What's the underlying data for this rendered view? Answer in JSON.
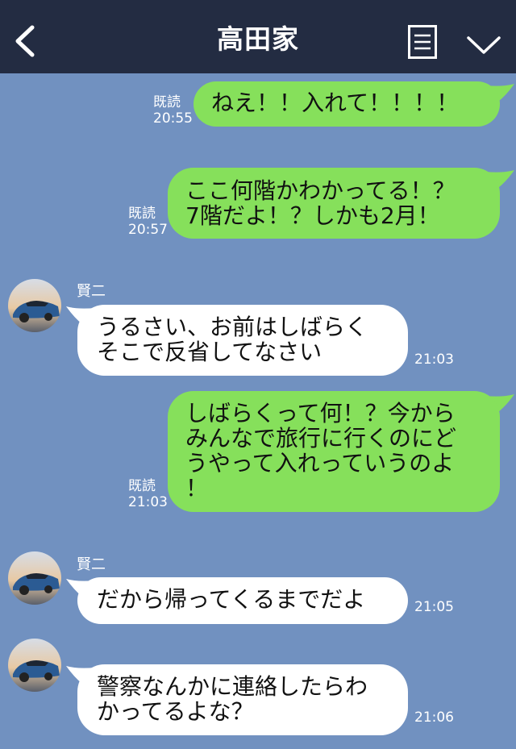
{
  "header": {
    "title": "高田家"
  },
  "messages": [
    {
      "side": "out",
      "read": "既読",
      "time": "20:55",
      "text": "ねえ！！入れて！！！！"
    },
    {
      "side": "out",
      "read": "既読",
      "time": "20:57",
      "lines": [
        "ここ何階かわかってる！？",
        "7階だよ！？しかも2月！"
      ]
    },
    {
      "side": "in",
      "sender": "賢二",
      "time": "21:03",
      "lines": [
        "うるさい、お前はしばらく",
        "そこで反省してなさい"
      ]
    },
    {
      "side": "out",
      "read": "既読",
      "time": "21:03",
      "lines": [
        "しばらくって何！？今から",
        "みんなで旅行に行くのにど",
        "うやって入れっていうのよ",
        "！"
      ]
    },
    {
      "side": "in",
      "sender": "賢二",
      "time": "21:05",
      "text": "だから帰ってくるまでだよ"
    },
    {
      "side": "in",
      "sender": "",
      "time": "21:06",
      "lines": [
        "警察なんかに連絡したらわ",
        "かってるよな？"
      ]
    }
  ],
  "colors": {
    "background": "#7191c0",
    "header": "#232c42",
    "outgoing": "#86e05b",
    "incoming": "#ffffff"
  },
  "icons": [
    "back-chevron-icon",
    "menu-icon",
    "chevron-down-icon",
    "car-avatar"
  ]
}
